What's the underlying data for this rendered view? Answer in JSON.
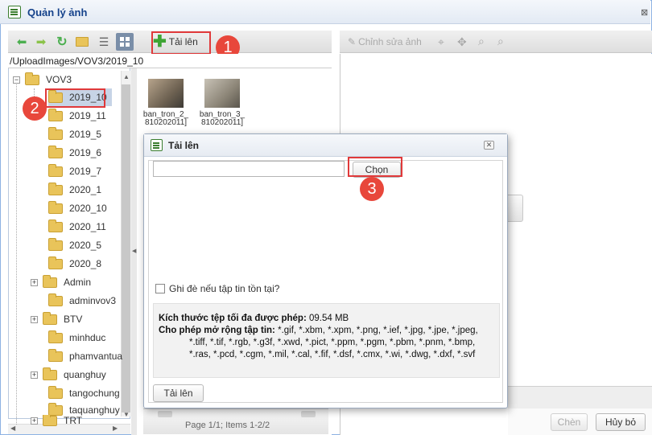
{
  "window": {
    "title": "Quản lý ảnh",
    "close": "⊠"
  },
  "toolbar": {
    "upload_label": "Tải lên"
  },
  "right_toolbar": {
    "edit_label": "Chỉnh sửa ảnh"
  },
  "path": "/UploadImages/VOV3/2019_10",
  "tree": {
    "root": "VOV3",
    "items": [
      {
        "label": "2019_10"
      },
      {
        "label": "2019_11"
      },
      {
        "label": "2019_5"
      },
      {
        "label": "2019_6"
      },
      {
        "label": "2019_7"
      },
      {
        "label": "2020_1"
      },
      {
        "label": "2020_10"
      },
      {
        "label": "2020_11"
      },
      {
        "label": "2020_5"
      },
      {
        "label": "2020_8"
      },
      {
        "label": "Admin"
      },
      {
        "label": "adminvov3"
      },
      {
        "label": "BTV"
      },
      {
        "label": "minhduc"
      },
      {
        "label": "phamvantua"
      },
      {
        "label": "quanghuy"
      },
      {
        "label": "tangochung"
      },
      {
        "label": "taquanghuy"
      },
      {
        "label": "TRT"
      }
    ]
  },
  "thumbnails": [
    {
      "line1": "ban_tron_2_",
      "line2": "810202011]"
    },
    {
      "line1": "ban_tron_3_",
      "line2": "810202011]"
    }
  ],
  "pager": {
    "text": "Page 1/1; Items 1-2/2"
  },
  "actions": {
    "insert": "Chèn",
    "cancel": "Hủy bỏ"
  },
  "dialog": {
    "title": "Tải lên",
    "file_value": "",
    "choose_button": "Chọn",
    "overwrite_label": "Ghi đè nếu tập tin tồn tại?",
    "max_size_label": "Kích thước tệp tối đa được phép:",
    "max_size_value": "09.54 MB",
    "ext_label": "Cho phép mở rộng tập tin:",
    "ext_line1": "*.gif, *.xbm, *.xpm, *.png, *.ief, *.jpg, *.jpe, *.jpeg,",
    "ext_line2": "*.tiff, *.tif, *.rgb, *.g3f, *.xwd, *.pict, *.ppm, *.pgm, *.pbm, *.pnm, *.bmp,",
    "ext_line3": "*.ras, *.pcd, *.cgm, *.mil, *.cal, *.fif, *.dsf, *.cmx, *.wi, *.dwg, *.dxf, *.svf",
    "upload_button": "Tải lên"
  },
  "callouts": [
    "1",
    "2",
    "3"
  ],
  "colors": {
    "accent": "#e8473b",
    "folder": "#e9c45a",
    "selected": "#c7d4e6"
  }
}
